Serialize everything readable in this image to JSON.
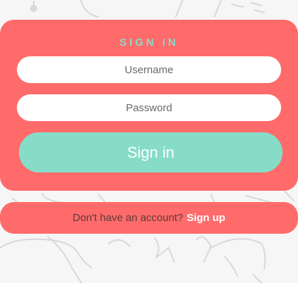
{
  "signin": {
    "title": "SIGN IN",
    "username_placeholder": "Username",
    "password_placeholder": "Password",
    "button_label": "Sign in"
  },
  "signup": {
    "prompt": "Don't have an account?",
    "link_label": "Sign up"
  },
  "colors": {
    "primary": "#ff6b6b",
    "accent": "#86dcc6",
    "background": "#f6f6f6"
  }
}
